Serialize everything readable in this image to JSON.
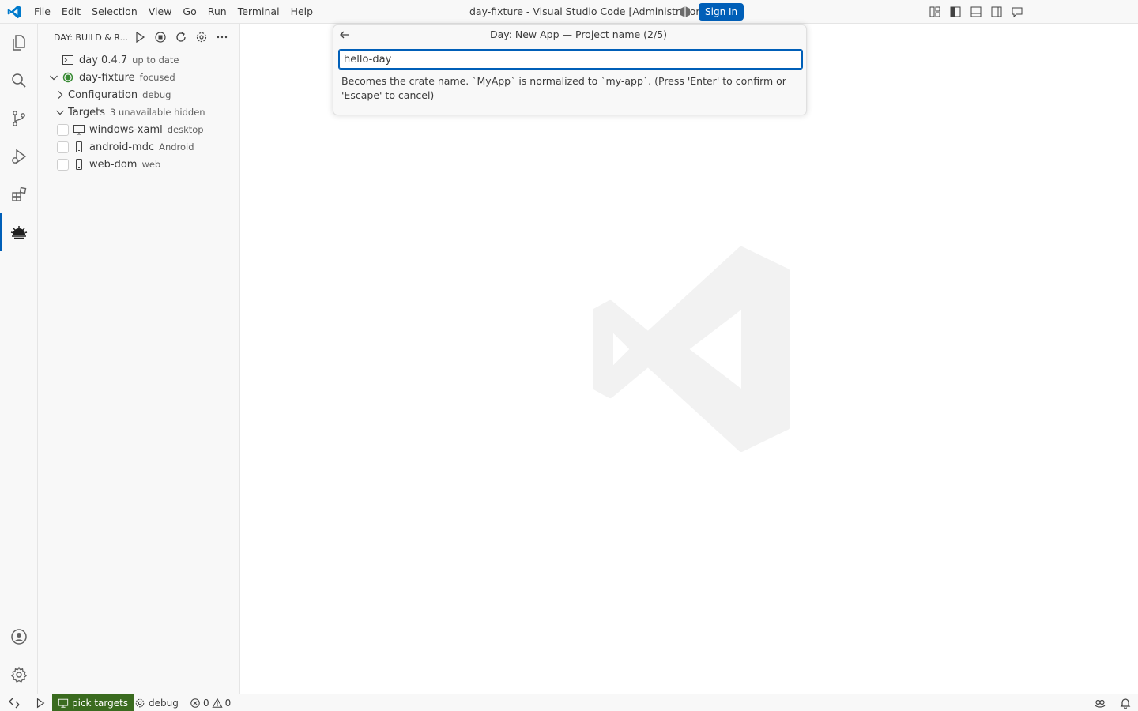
{
  "titlebar": {
    "menu": [
      "File",
      "Edit",
      "Selection",
      "View",
      "Go",
      "Run",
      "Terminal",
      "Help"
    ],
    "title": "day-fixture - Visual Studio Code [Administrator]",
    "sign_in": "Sign In"
  },
  "sidebar": {
    "title": "DAY: BUILD & R...",
    "rows": [
      {
        "label": "day 0.4.7",
        "desc": "up to date"
      },
      {
        "label": "day-fixture",
        "desc": "focused"
      },
      {
        "label": "Configuration",
        "desc": "debug"
      },
      {
        "label": "Targets",
        "desc": "3 unavailable hidden"
      },
      {
        "label": "windows-xaml",
        "desc": "desktop"
      },
      {
        "label": "android-mdc",
        "desc": "Android"
      },
      {
        "label": "web-dom",
        "desc": "web"
      }
    ]
  },
  "quickinput": {
    "title": "Day: New App — Project name (2/5)",
    "value": "hello-day",
    "message": "Becomes the crate name. `MyApp` is normalized to `my-app`. (Press 'Enter' to confirm or 'Escape' to cancel)"
  },
  "statusbar": {
    "targets": "pick targets",
    "config": "debug",
    "errors": "0",
    "warnings": "0"
  },
  "colors": {
    "accent": "#005fb8",
    "status_green": "#3a6b1f",
    "focused_dot": "#388a34"
  }
}
